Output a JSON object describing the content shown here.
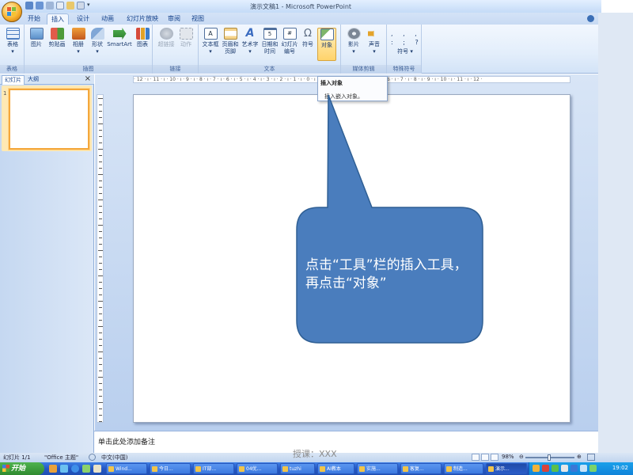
{
  "window": {
    "title": "演示文稿1 - Microsoft PowerPoint",
    "help_icon": "help-icon"
  },
  "tabs": [
    "开始",
    "插入",
    "设计",
    "动画",
    "幻灯片放映",
    "审阅",
    "视图"
  ],
  "active_tab": "插入",
  "ribbon": {
    "groups": {
      "tables": "表格",
      "illustrations": "插图",
      "links": "链接",
      "text": "文本",
      "media": "媒体剪辑",
      "symbols": "特殊符号"
    },
    "buttons": {
      "table": "表格",
      "picture": "图片",
      "clipart": "剪贴画",
      "album": "相册",
      "shapes": "形状",
      "smartart": "SmartArt",
      "chart": "图表",
      "hyperlink": "超链接",
      "action": "动作",
      "textbox_1": "文本框",
      "textbox_2": "▾",
      "header_footer_1": "页眉和",
      "header_footer_2": "页脚",
      "wordart_1": "艺术字",
      "wordart_2": "▾",
      "datetime_1": "日期和",
      "datetime_2": "时间",
      "slidenum_1": "幻灯片",
      "slidenum_2": "编号",
      "symbol": "符号",
      "object": "对象",
      "movie_1": "影片",
      "movie_2": "▾",
      "sound_1": "声音",
      "sound_2": "▾",
      "special_symbol": "符号 ▾"
    },
    "symbol_grid": ", , ,\n: ; ?"
  },
  "dropdown": {
    "title": "插入对象",
    "description": "插入嵌入对象。"
  },
  "left_pane": {
    "tab_slides": "幻灯片",
    "tab_outline": "大纲",
    "close": "×",
    "slide_number": "1"
  },
  "ruler": {
    "horizontal": "· 12 · ı · 11 · ı · 10 · ı · 9 · ı · 8 · ı · 7 · ı · 6 · ı · 5 · ı · 4 · ı · 3 · ı · 2 · ı · 1 · ı · 0 · ı · 1 · ı · 2 · ı · 3 · ı · 4 · ı · 5 · ı · 6 · ı · 7 · ı · 8 · ı · 9 · ı · 10 · ı · 11 · ı · 12 ·"
  },
  "callout": {
    "text": "点击“工具”栏的插入工具，再点击“对象”",
    "fill": "#4a7dbd",
    "stroke": "#2f5f94"
  },
  "notes": {
    "placeholder": "单击此处添加备注"
  },
  "watermark": "授课：XXX",
  "statusbar": {
    "slide_info": "幻灯片 1/1",
    "theme": "\"Office 主题\"",
    "language": "中文(中国)",
    "zoom": "98%",
    "zoom_level_percent": 98
  },
  "taskbar": {
    "start": "开始",
    "tasks": [
      "Wind...",
      "今日...",
      "IT部...",
      "04优...",
      "tuzhi",
      "AI教本",
      "实施...",
      "客复...",
      "制造...",
      "演示..."
    ],
    "clock": "19:02"
  }
}
